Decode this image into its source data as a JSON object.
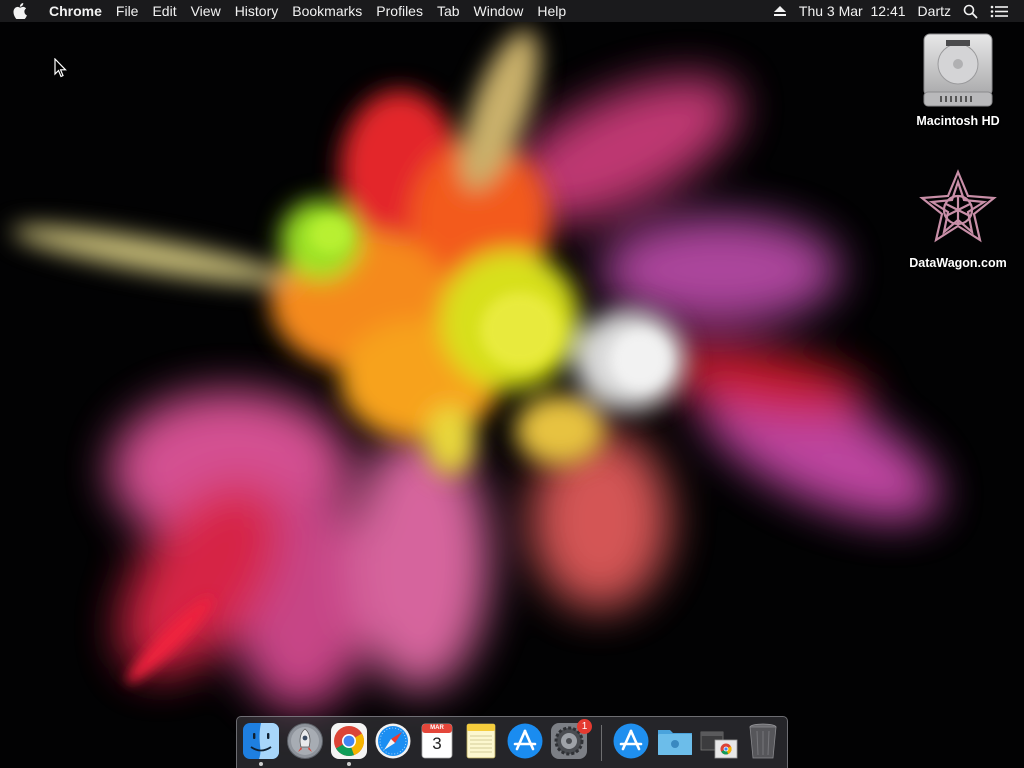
{
  "menubar": {
    "apple_icon": "apple-icon",
    "app_name": "Chrome",
    "menus": [
      "File",
      "Edit",
      "View",
      "History",
      "Bookmarks",
      "Profiles",
      "Tab",
      "Window",
      "Help"
    ],
    "status": {
      "eject_icon": "eject-icon",
      "datetime": "Thu 3 Mar  12:41",
      "user": "Dartz",
      "search_icon": "spotlight-search-icon",
      "list_icon": "notification-center-icon"
    }
  },
  "desktop_icons": [
    {
      "label": "Macintosh HD",
      "icon": "hard-drive-icon"
    },
    {
      "label": "DataWagon.com",
      "icon": "datawagon-logo-icon"
    }
  ],
  "dock": {
    "items": [
      {
        "name": "Finder",
        "icon": "finder-icon",
        "running": true
      },
      {
        "name": "Launchpad",
        "icon": "launchpad-icon",
        "running": false
      },
      {
        "name": "Google Chrome",
        "icon": "chrome-icon",
        "running": true
      },
      {
        "name": "Safari",
        "icon": "safari-icon",
        "running": false
      },
      {
        "name": "Calendar",
        "icon": "calendar-icon",
        "running": false,
        "month": "MAR",
        "day": "3"
      },
      {
        "name": "Notes",
        "icon": "notes-icon",
        "running": false
      },
      {
        "name": "App Store",
        "icon": "app-store-icon",
        "running": false
      },
      {
        "name": "System Preferences",
        "icon": "system-preferences-icon",
        "running": false,
        "badge": "1"
      },
      {
        "name": "Applications",
        "icon": "app-store-folder-icon",
        "running": false
      },
      {
        "name": "Documents",
        "icon": "folder-icon",
        "running": false
      },
      {
        "name": "Downloads",
        "icon": "downloads-stack-icon",
        "running": false
      },
      {
        "name": "Trash",
        "icon": "trash-icon",
        "running": false
      }
    ]
  },
  "colors": {
    "menubar_bg": "#1c1c1e",
    "wallpaper_bg": "#020203",
    "badge_red": "#e53a30"
  }
}
